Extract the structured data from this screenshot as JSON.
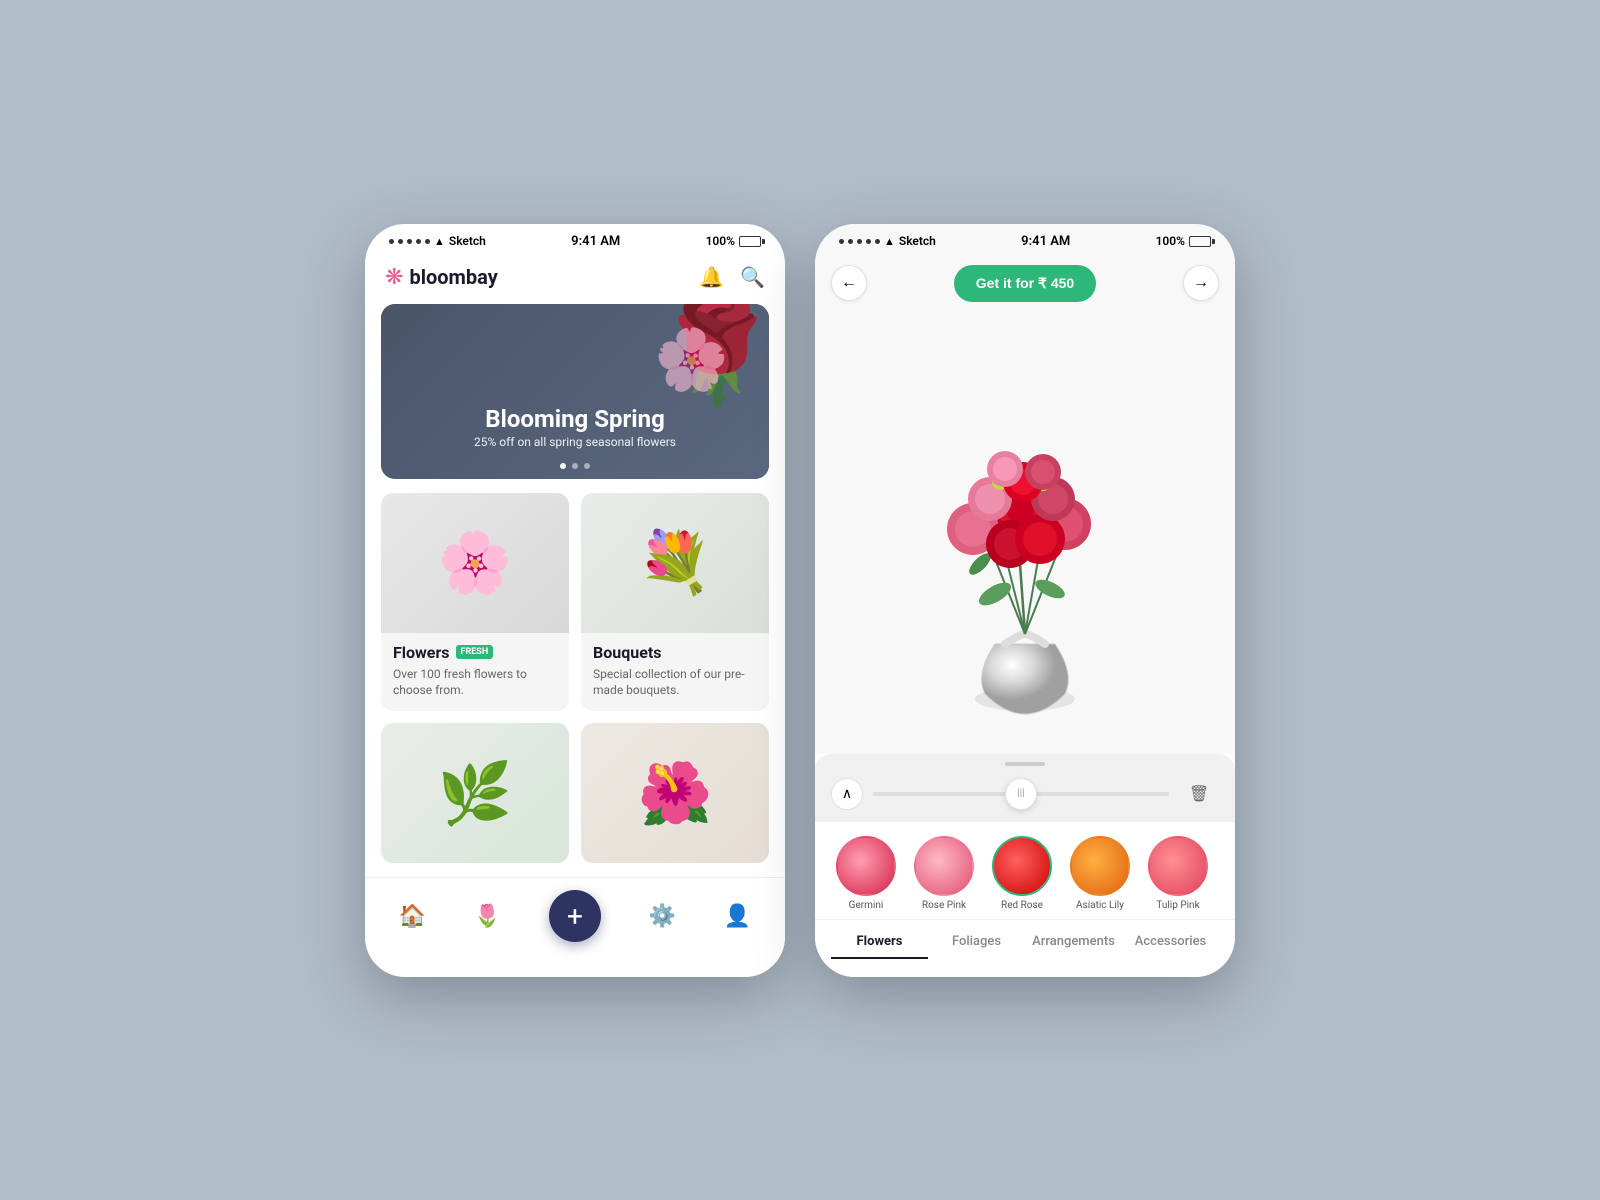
{
  "app": {
    "name": "bloombay",
    "status_time": "9:41 AM",
    "status_carrier": "Sketch",
    "status_battery": "100%"
  },
  "screen1": {
    "header": {
      "logo_icon": "❋",
      "logo_text": "bloombay"
    },
    "banner": {
      "title": "Blooming Spring",
      "subtitle": "25% off on all spring seasonal flowers",
      "dots": [
        "active",
        "",
        ""
      ]
    },
    "categories": [
      {
        "title": "Flowers",
        "badge": "FRESH",
        "description": "Over 100 fresh flowers to choose from.",
        "emoji": "🌸"
      },
      {
        "title": "Bouquets",
        "badge": "",
        "description": "Special collection of our pre-made bouquets.",
        "emoji": "💐"
      },
      {
        "title": "",
        "badge": "",
        "description": "",
        "emoji": "🌿"
      },
      {
        "title": "",
        "badge": "",
        "description": "",
        "emoji": "🌺"
      }
    ],
    "nav": {
      "home_label": "home",
      "flower_label": "flower",
      "add_label": "+",
      "settings_label": "settings",
      "profile_label": "profile"
    }
  },
  "screen2": {
    "header": {
      "buy_button": "Get it for ₹ 450",
      "back_label": "←",
      "forward_label": "→"
    },
    "flowers": [
      {
        "name": "Germini",
        "class": "f-germini",
        "selected": false
      },
      {
        "name": "Rose Pink",
        "class": "f-rose-pink",
        "selected": false
      },
      {
        "name": "Red Rose",
        "class": "f-red-rose",
        "selected": true
      },
      {
        "name": "Asiatic Lily",
        "class": "f-asiatic",
        "selected": false
      },
      {
        "name": "Tulip Pink",
        "class": "f-tulip",
        "selected": false
      }
    ],
    "tabs": [
      {
        "label": "Flowers",
        "active": true
      },
      {
        "label": "Foliages",
        "active": false
      },
      {
        "label": "Arrangements",
        "active": false
      },
      {
        "label": "Accessories",
        "active": false
      }
    ]
  }
}
